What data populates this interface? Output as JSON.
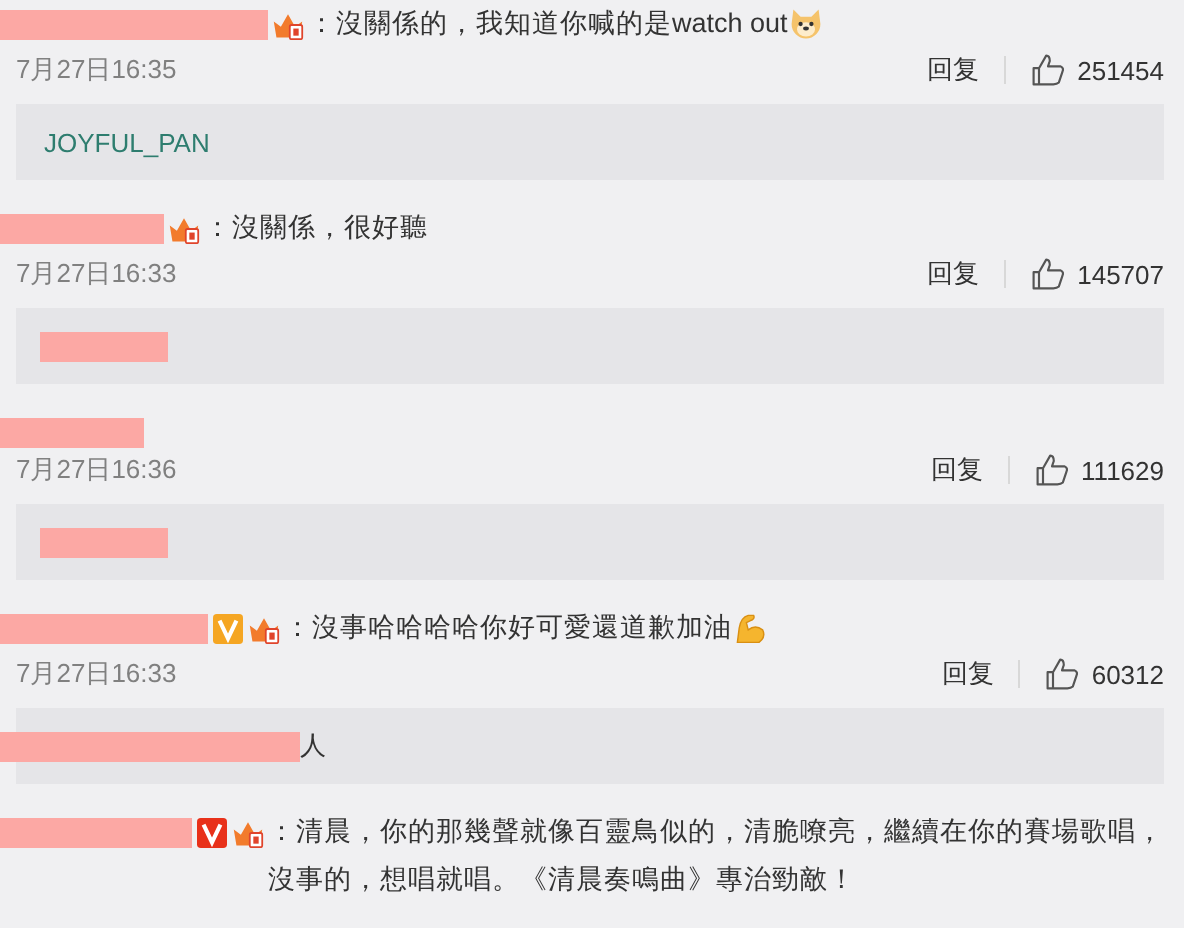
{
  "comments": [
    {
      "badges": [
        {
          "kind": "vip"
        }
      ],
      "text": "：沒關係的，我知道你喊的是watch out",
      "emoji": {
        "kind": "dog"
      },
      "time": "7月27日16:35",
      "reply_label": "回复",
      "likes": "251454",
      "reply": {
        "redacted": false,
        "text": "JOYFUL_PAN"
      }
    },
    {
      "badges": [
        {
          "kind": "vip"
        }
      ],
      "text": "：沒關係，很好聽",
      "time": "7月27日16:33",
      "reply_label": "回复",
      "likes": "145707",
      "reply": {
        "redacted": true
      }
    },
    {
      "time": "7月27日16:36",
      "reply_label": "回复",
      "likes": "111629",
      "reply": {
        "redacted": true
      }
    },
    {
      "badges": [
        {
          "kind": "verified",
          "color": "#f5a623"
        },
        {
          "kind": "vip"
        }
      ],
      "text": "：沒事哈哈哈哈你好可愛還道歉加油",
      "emoji": {
        "kind": "muscle"
      },
      "time": "7月27日16:33",
      "reply_label": "回复",
      "likes": "60312",
      "reply": {
        "redacted": true,
        "text": "人"
      }
    },
    {
      "badges": [
        {
          "kind": "verified",
          "color": "#e8311a"
        },
        {
          "kind": "vip"
        }
      ],
      "text": "：清晨，你的那幾聲就像百靈鳥似的，清脆嘹亮，繼續在你的賽場歌唱，沒事的，想唱就唱。《清晨奏鳴曲》專治勁敵！"
    }
  ]
}
